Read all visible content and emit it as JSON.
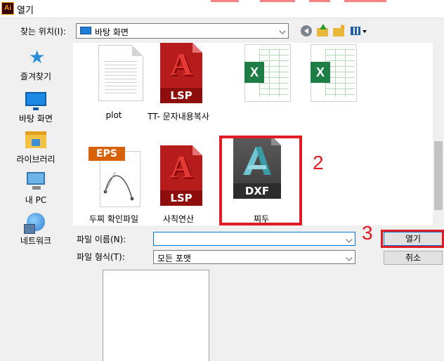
{
  "window": {
    "title": "열기",
    "app_icon_text": "Ai"
  },
  "toolbar": {
    "look_in_label": "찾는 위치(I):",
    "look_in_value": "바탕 화면",
    "back_icon": "back-arrow-icon",
    "up_icon": "up-folder-icon",
    "new_folder_icon": "new-folder-icon",
    "view_icon": "view-menu-icon"
  },
  "places": [
    {
      "label": "즐겨찾기",
      "icon": "star-icon"
    },
    {
      "label": "바탕 화면",
      "icon": "desktop-icon"
    },
    {
      "label": "라이브러리",
      "icon": "library-icon"
    },
    {
      "label": "내 PC",
      "icon": "computer-icon"
    },
    {
      "label": "네트워크",
      "icon": "network-icon"
    }
  ],
  "files": [
    {
      "name": "plot",
      "type": "document"
    },
    {
      "name": "TT- 문자내용복사",
      "type": "LSP",
      "tag": "LSP"
    },
    {
      "name": "",
      "type": "excel",
      "tag": "X"
    },
    {
      "name": "",
      "type": "excel",
      "tag": "X"
    },
    {
      "name": "두찌 확인파일",
      "type": "EPS",
      "tag": "EPS"
    },
    {
      "name": "사칙연산",
      "type": "LSP",
      "tag": "LSP"
    },
    {
      "name": "찌두",
      "type": "DXF",
      "tag": "DXF"
    }
  ],
  "annotations": {
    "step2": "2",
    "step3": "3"
  },
  "bottom": {
    "filename_label": "파일 이름(N):",
    "filename_value": "",
    "filetype_label": "파일 형식(T):",
    "filetype_value": "모든 포맷",
    "open_button": "열기",
    "cancel_button": "취소"
  },
  "colors": {
    "highlight": "#e01b24",
    "accent": "#0078d7"
  }
}
